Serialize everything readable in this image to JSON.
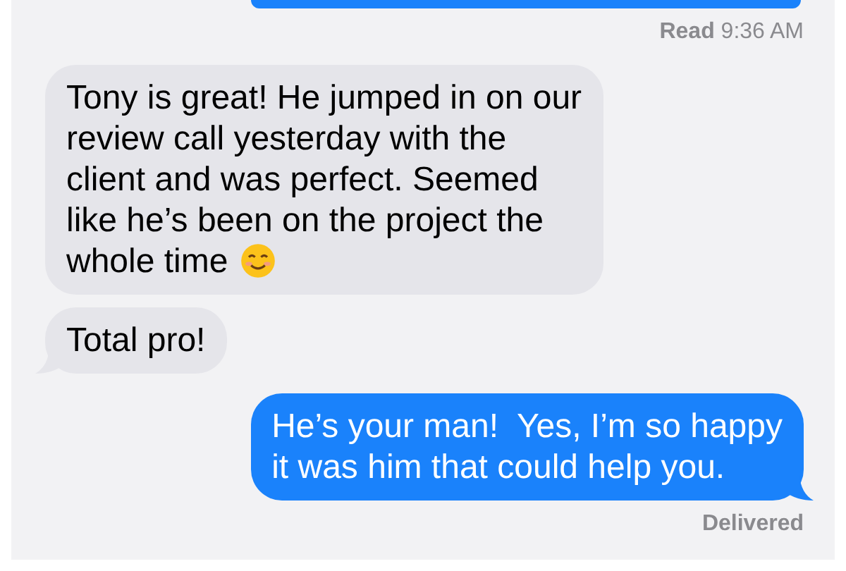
{
  "messages": [
    {
      "kind": "partial"
    },
    {
      "kind": "receipt",
      "text": "**Read** 9:36 AM"
    },
    {
      "kind": "received",
      "text": "Tony is great! He jumped in on our\nreview call yesterday with the\nclient and was perfect. Seemed\nlike he’s been on the project the\nwhole time",
      "emoji": true,
      "tail": false
    },
    {
      "kind": "received",
      "text": "Total pro!",
      "tail": true
    },
    {
      "kind": "sent",
      "text": "He’s your man!  Yes, I’m so happy\nit was him that could help you.",
      "tail": true
    },
    {
      "kind": "receipt",
      "text": "**Delivered**"
    }
  ]
}
